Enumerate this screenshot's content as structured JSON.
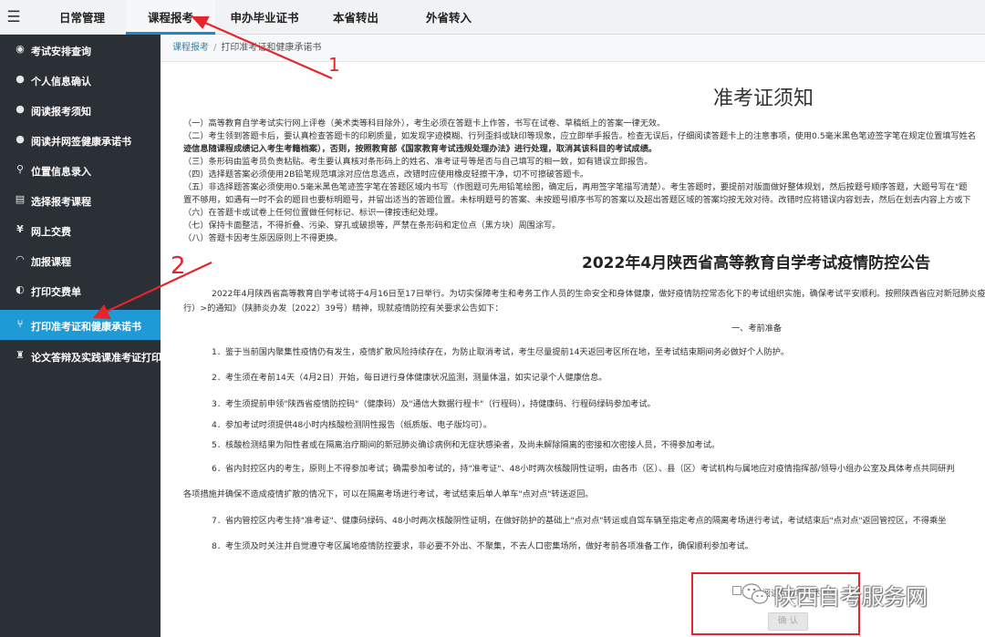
{
  "topnav": {
    "menu_icon": "hamburger-icon",
    "tabs": [
      {
        "label": "日常管理"
      },
      {
        "label": "课程报考"
      },
      {
        "label": "申办毕业证书"
      },
      {
        "label": "本省转出"
      },
      {
        "label": "外省转入"
      }
    ]
  },
  "sidebar": {
    "items": [
      {
        "label": "考试安排查询",
        "icon": "eye-icon"
      },
      {
        "label": "个人信息确认",
        "icon": "chat-icon"
      },
      {
        "label": "阅读报考须知",
        "icon": "chat-icon"
      },
      {
        "label": "阅读并网签健康承诺书",
        "icon": "chat-icon"
      },
      {
        "label": "位置信息录入",
        "icon": "location-pin-icon"
      },
      {
        "label": "选择报考课程",
        "icon": "database-icon"
      },
      {
        "label": "网上交费",
        "icon": "yen-icon"
      },
      {
        "label": "加报课程",
        "icon": "gauge-icon"
      },
      {
        "label": "打印交费单",
        "icon": "toggle-icon"
      },
      {
        "label": "打印准考证和健康承诺书",
        "icon": "sitemap-icon"
      },
      {
        "label": "论文答辩及实践课准考证打印",
        "icon": "trophy-icon"
      }
    ],
    "active_index": 9
  },
  "breadcrumb": {
    "parent": "课程报考",
    "separator": "/",
    "current": "打印准考证和健康承诺书"
  },
  "notice": {
    "title": "准考证须知",
    "rules": [
      "（一）高等教育自学考试实行网上评卷（美术类等科目除外），考生必须在答题卡上作答，书写在试卷、草稿纸上的答案一律无效。",
      "（二）考生领到答题卡后，要认真检查答题卡的印刷质量，如发现字迹模糊、行列歪斜或缺印等现象，应立即举手报告。检查无误后，仔细阅读答题卡上的注意事项，使用0.5毫米黑色笔迹签字笔在规定位置填写姓名",
      "迹信息随课程成绩记入考生考籍档案），否则，按照教育部《国家教育考试违规处理办法》进行处理，取消其该科目的考试成绩。",
      "（三）条形码由监考员负责粘贴。考生要认真核对条形码上的姓名、准考证号等是否与自己填写的相一致，如有错误立即报告。",
      "（四）选择题答案必须使用2B铅笔规范填涂对应信息选点，改错时应使用橡皮轻擦干净，切不可擦破答题卡。",
      "（五）非选择题答案必须使用0.5毫米黑色笔迹签字笔在答题区域内书写（作图题可先用铅笔绘图，确定后，再用签字笔描写清楚）。考生答题时，要提前对版面做好整体规划，然后按题号顺序答题，大题号写在\"题",
      "置不够用，如遇有一时不会的题目也要标明题号，并留出适当的答题位置。未标明题号的答案、未按题号顺序书写的答案以及超出答题区域的答案均按无效对待。改错时应将错误内容划去，然后在划去内容上方或下",
      "（六）在答题卡或试卷上任何位置做任何标记、标识一律按违纪处理。",
      "（七）保持卡面整洁，不得折叠、污染、穿孔或破损等，严禁在条形码和定位点（黑方块）周围涂写。",
      "（八）答题卡因考生原因原则上不得更换。"
    ]
  },
  "announcement": {
    "title": "2022年4月陕西省高等教育自学考试疫情防控公告",
    "intro_line1": "2022年4月陕西省高等教育自学考试将于4月16日至17日举行。为切实保障考生和考务工作人员的生命安全和身体健康，做好疫情防控常态化下的考试组织实施，确保考试平安顺利。按照陕西省应对新冠肺炎疫",
    "intro_line2": "行）>的通知》（陕肺炎办发〔2022〕39号）精神，现就疫情防控有关要求公告如下：",
    "section1": "一、考前准备",
    "items": [
      "1．鉴于当前国内聚集性疫情仍有发生，疫情扩散风险持续存在，为防止取消考试，考生尽量提前14天返回考区所在地，至考试结束期间务必做好个人防护。",
      "2．考生须在考前14天（4月2日）开始，每日进行身体健康状况监测，测量体温，如实记录个人健康信息。",
      "3．考生须提前申领\"陕西省疫情防控码\"（健康码）及\"通信大数据行程卡\"（行程码），持健康码、行程码绿码参加考试。",
      "4．参加考试时须提供48小时内核酸检测阴性报告（纸质版、电子版均可）。",
      "5．核酸检测结果为阳性者或在隔离治疗期间的新冠肺炎确诊病例和无症状感染者，及尚未解除隔离的密接和次密接人员，不得参加考试。",
      "6．省内封控区内的考生，原则上不得参加考试；确需参加考试的，持\"准考证\"、48小时两次核酸阴性证明，由各市（区）、县（区）考试机构与属地应对疫情指挥部/领导小组办公室及具体考点共同研判",
      "各项措施并确保不造成疫情扩散的情况下，可以在隔离考场进行考试，考试结束后单人单车\"点对点\"转送返回。",
      "7．省内管控区内考生持\"准考证\"、健康码绿码、48小时两次核酸阴性证明，在做好防护的基础上\"点对点\"转运或自驾车辆至指定考点的隔离考场进行考试，考试结束后\"点对点\"返回管控区，不得乘坐",
      "8．考生须及时关注并自觉遵守考区属地疫情防控要求，非必要不外出、不聚集，不去人口密集场所，做好考前各项准备工作，确保顺利参加考试。"
    ]
  },
  "agreement": {
    "text": "我已阅读并同意上述承诺",
    "confirm_label": "确 认"
  },
  "annotations": {
    "label1": "1",
    "label2": "2",
    "color": "#e3262c"
  },
  "watermark": {
    "text": "陕西自考服务网",
    "icon": "wechat-icon"
  },
  "colors": {
    "sidebar_bg": "#2b2f36",
    "active_blue": "#1e9ad6",
    "annotation_red": "#e3262c"
  }
}
